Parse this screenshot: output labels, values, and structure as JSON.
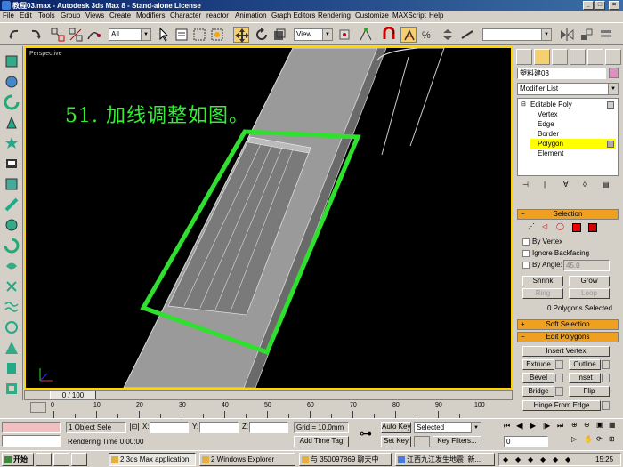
{
  "window": {
    "title": "教程03.max - Autodesk 3ds Max 8 - Stand-alone License",
    "min": "_",
    "max": "□",
    "close": "×"
  },
  "menu": [
    "File",
    "Edit",
    "Tools",
    "Group",
    "Views",
    "Create",
    "Modifiers",
    "Character",
    "reactor",
    "Animation",
    "Graph Editors",
    "Rendering",
    "Customize",
    "MAXScript",
    "Help"
  ],
  "toolbar": {
    "filter_value": "All",
    "refcoord_value": "View"
  },
  "viewport": {
    "label": "Perspective",
    "annotation": "51. 加线调整如图。"
  },
  "command_panel": {
    "object_name": "塑料建03",
    "modifier_list": "Modifier List",
    "stack": [
      {
        "label": "Editable Poly",
        "level": 0,
        "selected": false
      },
      {
        "label": "Vertex",
        "level": 1,
        "selected": false
      },
      {
        "label": "Edge",
        "level": 1,
        "selected": false
      },
      {
        "label": "Border",
        "level": 1,
        "selected": false
      },
      {
        "label": "Polygon",
        "level": 1,
        "selected": true
      },
      {
        "label": "Element",
        "level": 1,
        "selected": false
      }
    ],
    "selection": {
      "header": "Selection",
      "by_vertex": "By Vertex",
      "ignore_backfacing": "Ignore Backfacing",
      "by_angle": "By Angle:",
      "angle_value": "45.0",
      "shrink": "Shrink",
      "grow": "Grow",
      "ring": "Ring",
      "loop": "Loop",
      "status": "0 Polygons Selected"
    },
    "soft_selection": {
      "header": "Soft Selection"
    },
    "edit_polygons": {
      "header": "Edit Polygons",
      "insert_vertex": "Insert Vertex",
      "extrude": "Extrude",
      "outline": "Outline",
      "bevel": "Bevel",
      "inset": "Inset",
      "bridge": "Bridge",
      "flip": "Flip",
      "hinge": "Hinge From Edge"
    }
  },
  "timeline": {
    "frame": "0 / 100",
    "ticks": [
      "0",
      "10",
      "20",
      "30",
      "40",
      "50",
      "60",
      "70",
      "80",
      "90",
      "100"
    ]
  },
  "status": {
    "objects": "1 Object Sele",
    "render_time": "Rendering Time  0:00:00",
    "x_label": "X:",
    "y_label": "Y:",
    "z_label": "Z:",
    "grid": "Grid = 10.0mm",
    "add_time_tag": "Add Time Tag",
    "auto_key": "Auto Key",
    "set_key": "Set Key",
    "selected": "Selected",
    "key_filters": "Key Filters...",
    "frame_value": "0"
  },
  "taskbar": {
    "start": "开始",
    "tasks": [
      "2 3ds Max application",
      "2 Windows Explorer",
      "与 350097869 聊天中",
      "江西九江发生地震_新..."
    ],
    "clock": "15:25"
  },
  "colors": {
    "accent": "#ffd400",
    "annotation": "#33ee33",
    "rollout": "#f0a020",
    "selected_stack": "#ffff00"
  }
}
